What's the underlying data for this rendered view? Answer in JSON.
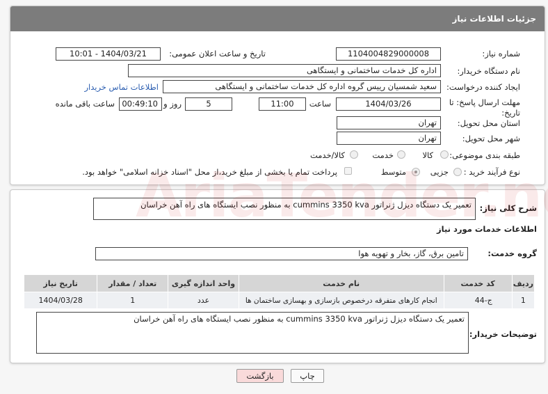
{
  "page_title": "جزئیات اطلاعات نیاز",
  "fields": {
    "need_number_label": "شماره نیاز:",
    "need_number": "1104004829000008",
    "announce_label": "تاریخ و ساعت اعلان عمومی:",
    "announce_value": "1404/03/21 - 10:01",
    "buyer_label": "نام دستگاه خریدار:",
    "buyer_value": "اداره کل خدمات ساختمانی و ایستگاهی",
    "creator_label": "ایجاد کننده درخواست:",
    "creator_value": "سعید شمسیان رییس گروه اداره کل خدمات ساختمانی و ایستگاهی",
    "contact_link": "اطلاعات تماس خریدار",
    "deadline_label": "مهلت ارسال پاسخ: تا تاریخ:",
    "deadline_date": "1404/03/26",
    "time_label": "ساعت",
    "deadline_time": "11:00",
    "days_value": "5",
    "days_label": "روز و",
    "remaining_time": "00:49:10",
    "remaining_label": "ساعت باقی مانده",
    "province_label": "استان محل تحویل:",
    "province_value": "تهران",
    "city_label": "شهر محل تحویل:",
    "city_value": "تهران",
    "category_label": "طبقه بندی موضوعی:",
    "category_options": [
      "کالا",
      "خدمت",
      "کالا/خدمت"
    ],
    "process_label": "نوع فرآیند خرید :",
    "process_options": [
      "جزیی",
      "متوسط"
    ],
    "payment_note": "پرداخت تمام یا بخشی از مبلغ خرید،از محل \"اسناد خزانه اسلامی\" خواهد بود."
  },
  "description": {
    "label": "شرح کلی نیاز:",
    "value": "تعمیر یک دستگاه دیزل ژنراتور cummins 3350 kva به منظور نصب ایستگاه های راه آهن خراسان"
  },
  "services": {
    "section_title": "اطلاعات خدمات مورد نیاز",
    "group_label": "گروه خدمت:",
    "group_value": "تامین برق، گاز، بخار و تهویه هوا",
    "columns": [
      "ردیف",
      "کد خدمت",
      "نام خدمت",
      "واحد اندازه گیری",
      "تعداد / مقدار",
      "تاریخ نیاز"
    ],
    "rows": [
      [
        "1",
        "ج-44",
        "انجام کارهای متفرقه درخصوص بازسازی و بهسازی ساختمان ها",
        "عدد",
        "1",
        "1404/03/28"
      ]
    ]
  },
  "buyer_notes": {
    "label": "توضیحات خریدار:",
    "value": "تعمیر یک دستگاه دیزل ژنراتور cummins 3350 kva به منظور نصب ایستگاه های راه آهن خراسان"
  },
  "buttons": {
    "print": "چاپ",
    "back": "بازگشت"
  },
  "colors": {
    "header_bg": "#7c7c7c",
    "link": "#2a5db0",
    "back_button_bg": "#f9dada"
  }
}
